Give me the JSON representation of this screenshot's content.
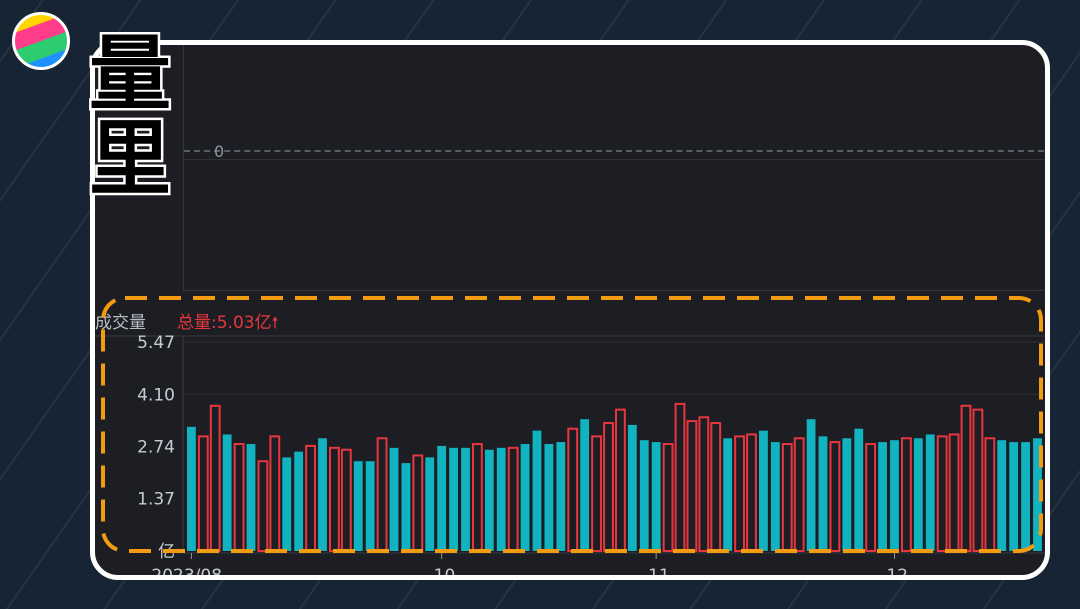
{
  "overlay": {
    "title_chars": [
      "量",
      "里"
    ]
  },
  "top_panel": {
    "zero_label": "0"
  },
  "volume_panel": {
    "label": "成交量",
    "total": "总量:5.03亿",
    "arrow_icon": "up-arrow-icon"
  },
  "colors": {
    "up": "#e8363f",
    "down": "#12b3c0",
    "highlight": "#f39c12"
  },
  "chart_data": {
    "type": "bar",
    "ylabel": "",
    "yticks": [
      "5.47",
      "4.10",
      "2.74",
      "1.37",
      "亿"
    ],
    "ylim": [
      0,
      5.47
    ],
    "xticks": [
      {
        "label": "2023/08",
        "index": 0
      },
      {
        "label": "10",
        "index": 21
      },
      {
        "label": "11",
        "index": 39
      },
      {
        "label": "12",
        "index": 59
      }
    ],
    "values": [
      3.25,
      3.0,
      3.8,
      3.05,
      2.8,
      2.8,
      2.35,
      3.0,
      2.45,
      2.6,
      2.75,
      2.95,
      2.7,
      2.65,
      2.35,
      2.35,
      2.95,
      2.7,
      2.3,
      2.5,
      2.45,
      2.75,
      2.7,
      2.7,
      2.8,
      2.65,
      2.7,
      2.7,
      2.8,
      3.15,
      2.8,
      2.85,
      3.2,
      3.45,
      3.0,
      3.35,
      3.7,
      3.3,
      2.9,
      2.85,
      2.8,
      3.85,
      3.4,
      3.5,
      3.35,
      2.95,
      3.0,
      3.05,
      3.15,
      2.85,
      2.8,
      2.95,
      3.45,
      3.0,
      2.85,
      2.95,
      3.2,
      2.8,
      2.85,
      2.9,
      2.95,
      2.95,
      3.05,
      3.0,
      3.05,
      3.8,
      3.7,
      2.95,
      2.9,
      2.85,
      2.85,
      2.95
    ],
    "colors": [
      "down",
      "up",
      "up",
      "down",
      "up",
      "down",
      "up",
      "up",
      "down",
      "down",
      "up",
      "down",
      "up",
      "up",
      "down",
      "down",
      "up",
      "down",
      "down",
      "up",
      "down",
      "down",
      "down",
      "down",
      "up",
      "down",
      "down",
      "up",
      "down",
      "down",
      "down",
      "down",
      "up",
      "down",
      "up",
      "up",
      "up",
      "down",
      "down",
      "down",
      "up",
      "up",
      "up",
      "up",
      "up",
      "down",
      "up",
      "up",
      "down",
      "down",
      "up",
      "up",
      "down",
      "down",
      "up",
      "down",
      "down",
      "up",
      "down",
      "down",
      "up",
      "down",
      "down",
      "up",
      "up",
      "up",
      "up",
      "up",
      "down",
      "down",
      "down",
      "down"
    ]
  }
}
